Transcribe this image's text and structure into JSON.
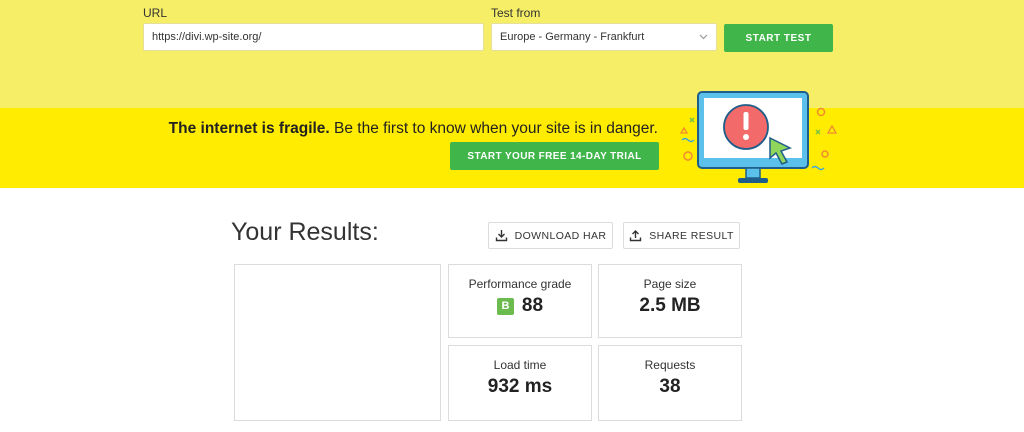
{
  "test_form": {
    "url_label": "URL",
    "url_value": "https://divi.wp-site.org/",
    "location_label": "Test from",
    "location_value": "Europe - Germany - Frankfurt",
    "start_label": "START TEST"
  },
  "banner": {
    "tagline_bold": "The internet is fragile.",
    "tagline_rest": " Be the first to know when your site is in danger.",
    "trial_label": "START YOUR FREE 14-DAY TRIAL"
  },
  "results": {
    "title": "Your Results:",
    "download_label": "DOWNLOAD HAR",
    "share_label": "SHARE RESULT",
    "metrics": {
      "performance": {
        "label": "Performance grade",
        "grade": "B",
        "value": "88"
      },
      "page_size": {
        "label": "Page size",
        "value": "2.5 MB"
      },
      "load_time": {
        "label": "Load time",
        "value": "932 ms"
      },
      "requests": {
        "label": "Requests",
        "value": "38"
      }
    }
  },
  "colors": {
    "top_bg": "#f5ee66",
    "banner_bg": "#ffec00",
    "button_green": "#3fb54a",
    "grade_green": "#6cbb4e"
  }
}
